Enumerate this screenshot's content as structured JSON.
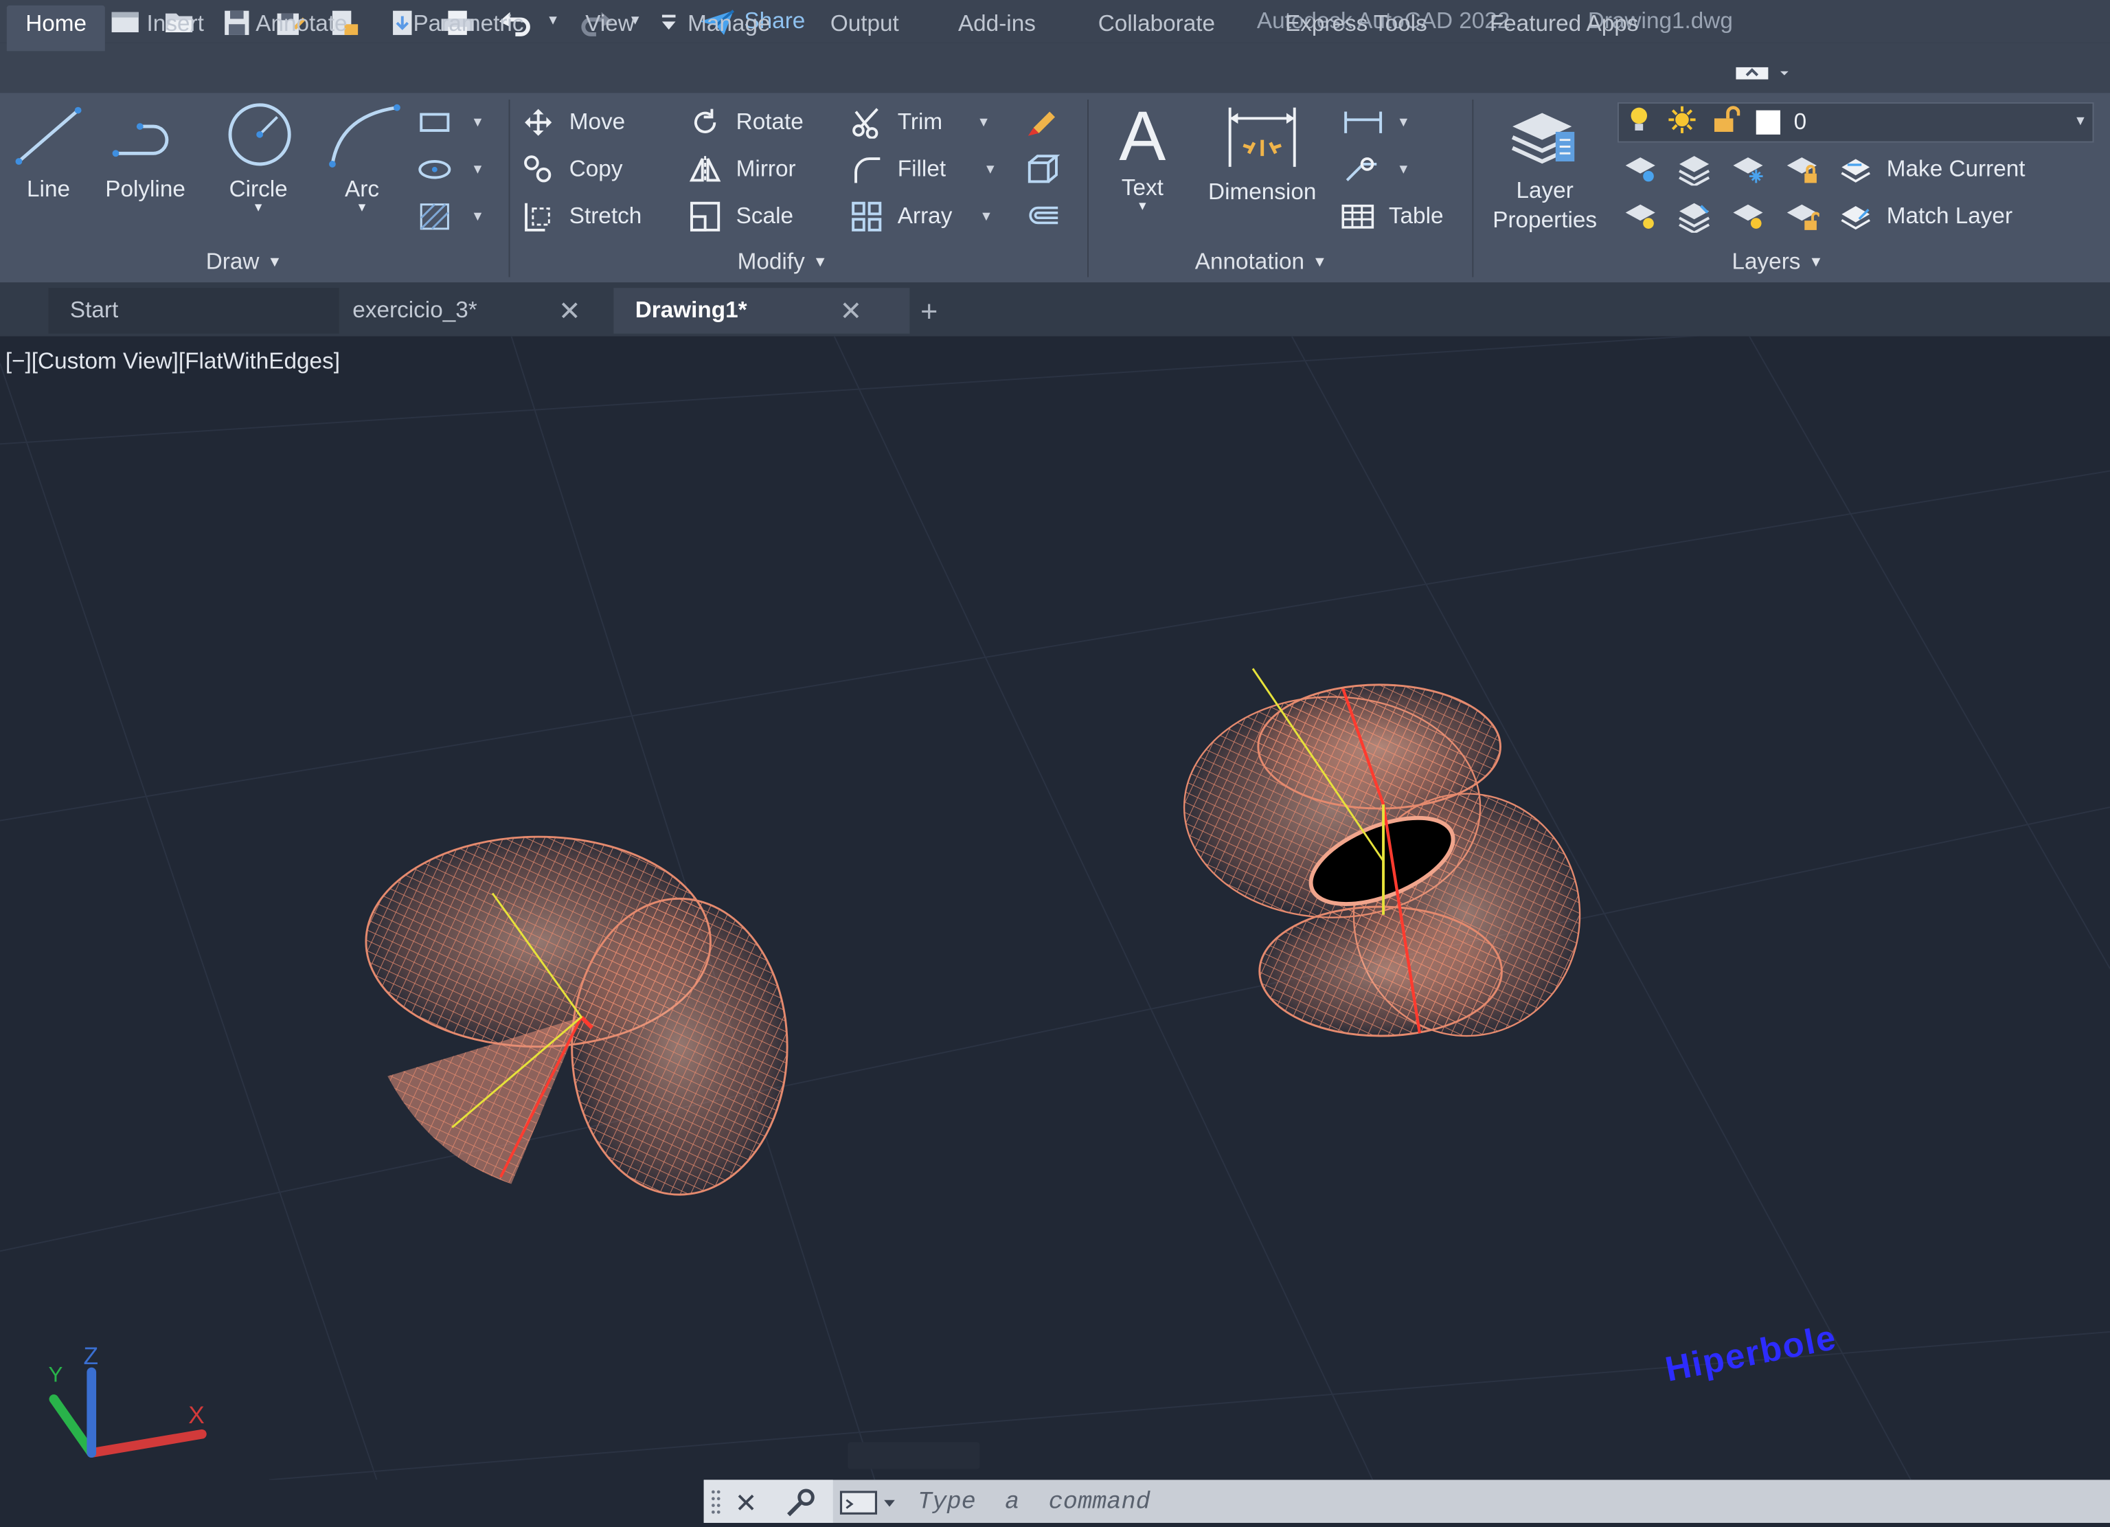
{
  "window": {
    "app_title": "Autodesk AutoCAD 2022",
    "file_name": "Drawing1.dwg",
    "share_label": "Share"
  },
  "quick_access": [
    "app-menu-icon",
    "new-icon",
    "open-icon",
    "save-icon",
    "save-as-icon",
    "open-web-icon",
    "save-web-icon",
    "plot-icon",
    "undo-icon",
    "redo-icon",
    "customize-icon",
    "share-icon"
  ],
  "ribbon_tabs": [
    "Home",
    "Insert",
    "Annotate",
    "Parametric",
    "View",
    "Manage",
    "Output",
    "Add-ins",
    "Collaborate",
    "Express Tools",
    "Featured Apps"
  ],
  "draw": {
    "title": "Draw",
    "line": "Line",
    "polyline": "Polyline",
    "circle": "Circle",
    "arc": "Arc"
  },
  "modify": {
    "title": "Modify",
    "move": "Move",
    "rotate": "Rotate",
    "trim": "Trim",
    "copy": "Copy",
    "mirror": "Mirror",
    "fillet": "Fillet",
    "stretch": "Stretch",
    "scale": "Scale",
    "array": "Array"
  },
  "annotation": {
    "title": "Annotation",
    "text": "Text",
    "dimension": "Dimension",
    "table": "Table"
  },
  "layers": {
    "title": "Layers",
    "layer_properties_1": "Layer",
    "layer_properties_2": "Properties",
    "current_layer": "0",
    "make_current": "Make Current",
    "match_layer": "Match Layer"
  },
  "doc_tabs": {
    "start": "Start",
    "tab1": "exercicio_3*",
    "tab2": "Drawing1*",
    "new_tab": "+"
  },
  "viewport": {
    "label": "[−][Custom View][FlatWithEdges]",
    "annotation_text": "Hiperbole",
    "ucs": {
      "x": "X",
      "y": "Y",
      "z": "Z"
    }
  },
  "command": {
    "placeholder": "Type  a  command"
  },
  "colors": {
    "background": "#212835",
    "ribbon": "#4a5466",
    "mesh": "#e58a6e",
    "axis_red": "#ff3b2f",
    "axis_yellow": "#e6e23a",
    "text_blue": "#2d2cff"
  }
}
